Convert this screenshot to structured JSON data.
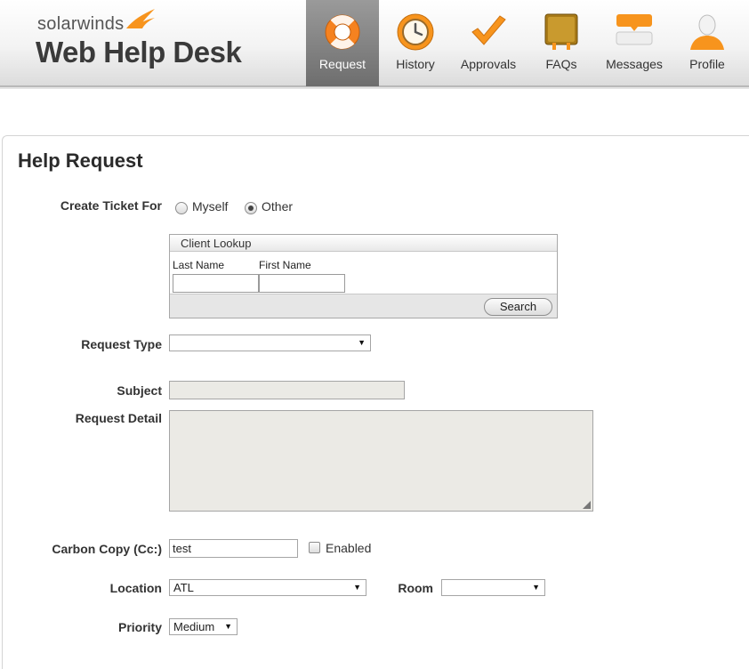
{
  "brand": {
    "top": "solarwinds",
    "main": "Web Help Desk"
  },
  "nav": [
    {
      "label": "Request",
      "icon": "lifebuoy-icon",
      "active": true
    },
    {
      "label": "History",
      "icon": "clock-icon"
    },
    {
      "label": "Approvals",
      "icon": "checkmark-icon"
    },
    {
      "label": "FAQs",
      "icon": "book-icon"
    },
    {
      "label": "Messages",
      "icon": "chat-bubble-icon"
    },
    {
      "label": "Profile",
      "icon": "person-icon"
    }
  ],
  "page": {
    "title": "Help Request"
  },
  "form": {
    "create_ticket_for": {
      "label": "Create Ticket For",
      "options": [
        "Myself",
        "Other"
      ],
      "selected": "Other"
    },
    "client_lookup": {
      "title": "Client Lookup",
      "last_name_label": "Last Name",
      "first_name_label": "First Name",
      "last_name_value": "",
      "first_name_value": "",
      "search_label": "Search"
    },
    "request_type": {
      "label": "Request Type",
      "value": ""
    },
    "subject": {
      "label": "Subject",
      "value": ""
    },
    "request_detail": {
      "label": "Request Detail",
      "value": ""
    },
    "carbon_copy": {
      "label": "Carbon Copy (Cc:)",
      "value": "test",
      "enabled_label": "Enabled",
      "enabled": false
    },
    "location": {
      "label": "Location",
      "value": "ATL"
    },
    "room": {
      "label": "Room",
      "value": ""
    },
    "priority": {
      "label": "Priority",
      "value": "Medium"
    }
  },
  "colors": {
    "accent_orange": "#f7941d",
    "active_tab": "#7a7a7a"
  }
}
